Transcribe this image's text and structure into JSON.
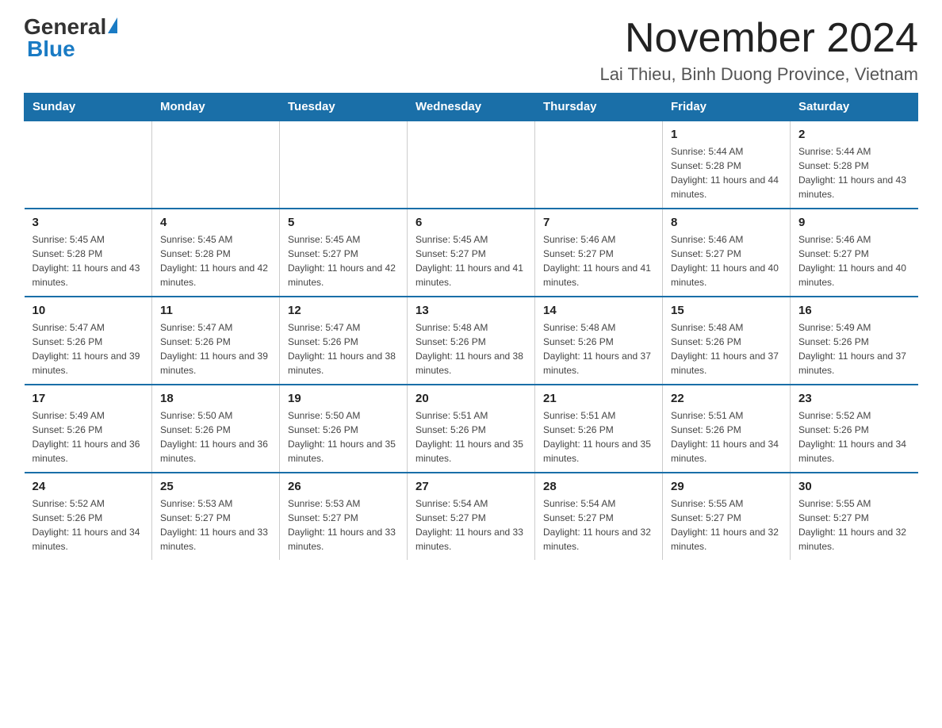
{
  "logo": {
    "general": "General",
    "blue": "Blue"
  },
  "header": {
    "title": "November 2024",
    "subtitle": "Lai Thieu, Binh Duong Province, Vietnam"
  },
  "days_of_week": [
    "Sunday",
    "Monday",
    "Tuesday",
    "Wednesday",
    "Thursday",
    "Friday",
    "Saturday"
  ],
  "weeks": [
    [
      {
        "day": "",
        "info": ""
      },
      {
        "day": "",
        "info": ""
      },
      {
        "day": "",
        "info": ""
      },
      {
        "day": "",
        "info": ""
      },
      {
        "day": "",
        "info": ""
      },
      {
        "day": "1",
        "info": "Sunrise: 5:44 AM\nSunset: 5:28 PM\nDaylight: 11 hours and 44 minutes."
      },
      {
        "day": "2",
        "info": "Sunrise: 5:44 AM\nSunset: 5:28 PM\nDaylight: 11 hours and 43 minutes."
      }
    ],
    [
      {
        "day": "3",
        "info": "Sunrise: 5:45 AM\nSunset: 5:28 PM\nDaylight: 11 hours and 43 minutes."
      },
      {
        "day": "4",
        "info": "Sunrise: 5:45 AM\nSunset: 5:28 PM\nDaylight: 11 hours and 42 minutes."
      },
      {
        "day": "5",
        "info": "Sunrise: 5:45 AM\nSunset: 5:27 PM\nDaylight: 11 hours and 42 minutes."
      },
      {
        "day": "6",
        "info": "Sunrise: 5:45 AM\nSunset: 5:27 PM\nDaylight: 11 hours and 41 minutes."
      },
      {
        "day": "7",
        "info": "Sunrise: 5:46 AM\nSunset: 5:27 PM\nDaylight: 11 hours and 41 minutes."
      },
      {
        "day": "8",
        "info": "Sunrise: 5:46 AM\nSunset: 5:27 PM\nDaylight: 11 hours and 40 minutes."
      },
      {
        "day": "9",
        "info": "Sunrise: 5:46 AM\nSunset: 5:27 PM\nDaylight: 11 hours and 40 minutes."
      }
    ],
    [
      {
        "day": "10",
        "info": "Sunrise: 5:47 AM\nSunset: 5:26 PM\nDaylight: 11 hours and 39 minutes."
      },
      {
        "day": "11",
        "info": "Sunrise: 5:47 AM\nSunset: 5:26 PM\nDaylight: 11 hours and 39 minutes."
      },
      {
        "day": "12",
        "info": "Sunrise: 5:47 AM\nSunset: 5:26 PM\nDaylight: 11 hours and 38 minutes."
      },
      {
        "day": "13",
        "info": "Sunrise: 5:48 AM\nSunset: 5:26 PM\nDaylight: 11 hours and 38 minutes."
      },
      {
        "day": "14",
        "info": "Sunrise: 5:48 AM\nSunset: 5:26 PM\nDaylight: 11 hours and 37 minutes."
      },
      {
        "day": "15",
        "info": "Sunrise: 5:48 AM\nSunset: 5:26 PM\nDaylight: 11 hours and 37 minutes."
      },
      {
        "day": "16",
        "info": "Sunrise: 5:49 AM\nSunset: 5:26 PM\nDaylight: 11 hours and 37 minutes."
      }
    ],
    [
      {
        "day": "17",
        "info": "Sunrise: 5:49 AM\nSunset: 5:26 PM\nDaylight: 11 hours and 36 minutes."
      },
      {
        "day": "18",
        "info": "Sunrise: 5:50 AM\nSunset: 5:26 PM\nDaylight: 11 hours and 36 minutes."
      },
      {
        "day": "19",
        "info": "Sunrise: 5:50 AM\nSunset: 5:26 PM\nDaylight: 11 hours and 35 minutes."
      },
      {
        "day": "20",
        "info": "Sunrise: 5:51 AM\nSunset: 5:26 PM\nDaylight: 11 hours and 35 minutes."
      },
      {
        "day": "21",
        "info": "Sunrise: 5:51 AM\nSunset: 5:26 PM\nDaylight: 11 hours and 35 minutes."
      },
      {
        "day": "22",
        "info": "Sunrise: 5:51 AM\nSunset: 5:26 PM\nDaylight: 11 hours and 34 minutes."
      },
      {
        "day": "23",
        "info": "Sunrise: 5:52 AM\nSunset: 5:26 PM\nDaylight: 11 hours and 34 minutes."
      }
    ],
    [
      {
        "day": "24",
        "info": "Sunrise: 5:52 AM\nSunset: 5:26 PM\nDaylight: 11 hours and 34 minutes."
      },
      {
        "day": "25",
        "info": "Sunrise: 5:53 AM\nSunset: 5:27 PM\nDaylight: 11 hours and 33 minutes."
      },
      {
        "day": "26",
        "info": "Sunrise: 5:53 AM\nSunset: 5:27 PM\nDaylight: 11 hours and 33 minutes."
      },
      {
        "day": "27",
        "info": "Sunrise: 5:54 AM\nSunset: 5:27 PM\nDaylight: 11 hours and 33 minutes."
      },
      {
        "day": "28",
        "info": "Sunrise: 5:54 AM\nSunset: 5:27 PM\nDaylight: 11 hours and 32 minutes."
      },
      {
        "day": "29",
        "info": "Sunrise: 5:55 AM\nSunset: 5:27 PM\nDaylight: 11 hours and 32 minutes."
      },
      {
        "day": "30",
        "info": "Sunrise: 5:55 AM\nSunset: 5:27 PM\nDaylight: 11 hours and 32 minutes."
      }
    ]
  ]
}
